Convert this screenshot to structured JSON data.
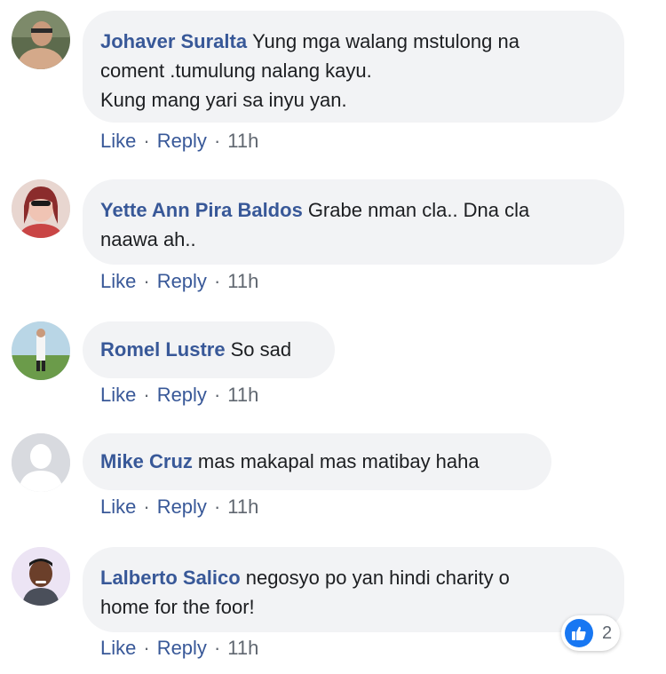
{
  "comments": [
    {
      "author": "Johaver Suralta",
      "text_line1": "Yung mga walang mstulong na",
      "text_line2": "coment .tumulung nalang kayu.",
      "text_line3": "Kung mang yari sa inyu yan.",
      "like": "Like",
      "reply": "Reply",
      "time": "11h"
    },
    {
      "author": "Yette Ann Pira Baldos",
      "text_line1": "Grabe nman cla.. Dna cla",
      "text_line2": "naawa ah..",
      "like": "Like",
      "reply": "Reply",
      "time": "11h"
    },
    {
      "author": "Romel Lustre",
      "text_line1": "So sad",
      "like": "Like",
      "reply": "Reply",
      "time": "11h"
    },
    {
      "author": "Mike Cruz",
      "text_line1": "mas makapal mas matibay haha",
      "like": "Like",
      "reply": "Reply",
      "time": "11h"
    },
    {
      "author": "Lalberto Salico",
      "text_line1": "negosyo po yan hindi charity o",
      "text_line2": "home for the foor!",
      "like": "Like",
      "reply": "Reply",
      "time": "11h",
      "reactions": {
        "icon": "thumbs-up-icon",
        "count": "2"
      }
    }
  ],
  "separator": "·",
  "colors": {
    "name": "#385898",
    "bubble": "#f2f3f5",
    "meta": "#606770",
    "like_badge": "#1877f2"
  }
}
